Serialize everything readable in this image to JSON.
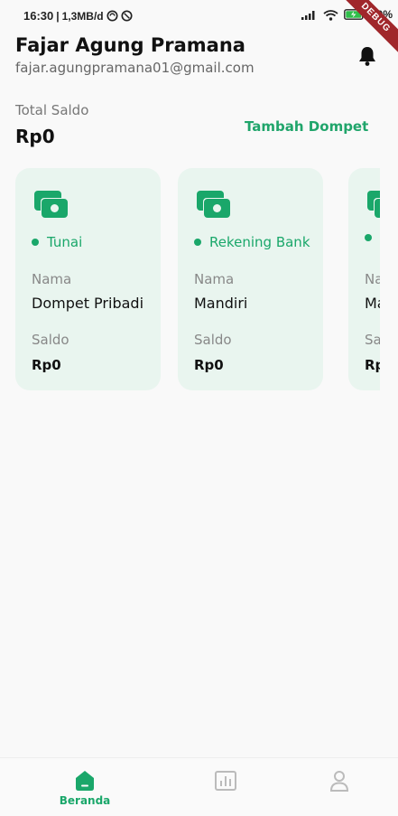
{
  "status_bar": {
    "time": "16:30",
    "network_speed": "1,3MB/d",
    "battery": "90%"
  },
  "debug_banner": "DEBUG",
  "header": {
    "name": "Fajar Agung Pramana",
    "email": "fajar.agungpramana01@gmail.com",
    "notification_icon": "bell-icon"
  },
  "balance": {
    "label": "Total Saldo",
    "value": "Rp0",
    "add_wallet_label": "Tambah Dompet"
  },
  "wallets": [
    {
      "icon": "money-icon",
      "type": "Tunai",
      "name_label": "Nama",
      "name": "Dompet Pribadi",
      "balance_label": "Saldo",
      "balance": "Rp0"
    },
    {
      "icon": "money-icon",
      "type": "Rekening Bank",
      "name_label": "Nama",
      "name": "Mandiri",
      "balance_label": "Saldo",
      "balance": "Rp0"
    },
    {
      "icon": "money-icon",
      "type": "",
      "name_label": "Na",
      "name": "Ma",
      "balance_label": "Sa",
      "balance": "Rp"
    }
  ],
  "bottom_nav": [
    {
      "label": "Beranda",
      "icon": "home-icon",
      "active": true
    },
    {
      "label": "",
      "icon": "chart-icon",
      "active": false
    },
    {
      "label": "",
      "icon": "profile-icon",
      "active": false
    }
  ],
  "colors": {
    "accent": "#1aa76a",
    "card_bg": "#e9f5ef",
    "background": "#f9f9f9"
  }
}
